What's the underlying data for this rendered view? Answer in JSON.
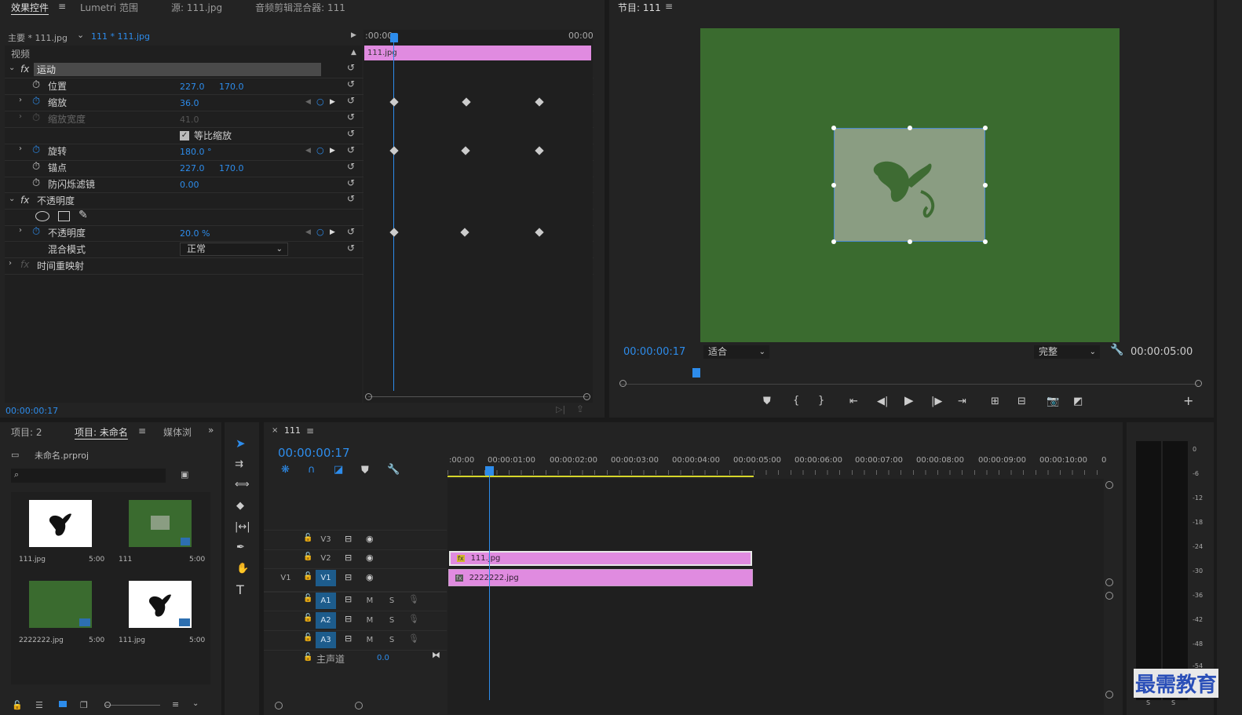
{
  "effect_panel": {
    "tabs": [
      "效果控件",
      "Lumetri 范围",
      "源: 111.jpg",
      "音频剪辑混合器: 111"
    ],
    "menu_icon": "≡",
    "master": "主要 * 111.jpg",
    "sequence": "111 * 111.jpg",
    "video_label": "视频",
    "motion": "运动",
    "position_label": "位置",
    "position_x": "227.0",
    "position_y": "170.0",
    "scale_label": "缩放",
    "scale_val": "36.0",
    "scale_width_label": "缩放宽度",
    "scale_width_val": "41.0",
    "uniform_label": "等比缩放",
    "rotation_label": "旋转",
    "rotation_val": "180.0 °",
    "anchor_label": "锚点",
    "anchor_x": "227.0",
    "anchor_y": "170.0",
    "flicker_label": "防闪烁滤镜",
    "flicker_val": "0.00",
    "opacity_section": "不透明度",
    "opacity_label": "不透明度",
    "opacity_val": "20.0 %",
    "blend_label": "混合模式",
    "blend_val": "正常",
    "timeremap_label": "时间重映射",
    "time_start": ":00:00",
    "time_end": "00:00",
    "clip_name": "111.jpg",
    "current_time": "00:00:00:17"
  },
  "program": {
    "title": "节目: 111",
    "timecode": "00:00:00:17",
    "fit": "适合",
    "quality": "完整",
    "duration": "00:00:05:00"
  },
  "project": {
    "tabs": [
      "项目: 2",
      "项目: 未命名",
      "媒体浏"
    ],
    "file": "未命名.prproj",
    "items": [
      {
        "name": "111.jpg",
        "dur": "5:00"
      },
      {
        "name": "111",
        "dur": "5:00"
      },
      {
        "name": "2222222.jpg",
        "dur": "5:00"
      },
      {
        "name": "111.jpg",
        "dur": "5:00"
      }
    ]
  },
  "timeline": {
    "tab": "111",
    "timecode": "00:00:00:17",
    "ruler": [
      ":00:00",
      "00:00:01:00",
      "00:00:02:00",
      "00:00:03:00",
      "00:00:04:00",
      "00:00:05:00",
      "00:00:06:00",
      "00:00:07:00",
      "00:00:08:00",
      "00:00:09:00",
      "00:00:10:00",
      "0"
    ],
    "tracks": {
      "v3": "V3",
      "v2": "V2",
      "v1": "V1",
      "v1_src": "V1",
      "a1": "A1",
      "a2": "A2",
      "a3": "A3"
    },
    "m": "M",
    "s": "S",
    "master": "主声道",
    "master_val": "0.0",
    "clip_v2": "111.jpg",
    "clip_v1": "2222222.jpg",
    "fx": "fx"
  },
  "meter": {
    "scale": [
      "0",
      "-6",
      "-12",
      "-18",
      "-24",
      "-30",
      "-36",
      "-42",
      "-48",
      "-54"
    ],
    "s": "S"
  },
  "watermark": "最需教育",
  "colors": {
    "accent": "#2d8ceb",
    "clip": "#e08be0",
    "green": "#3a6b2f"
  }
}
